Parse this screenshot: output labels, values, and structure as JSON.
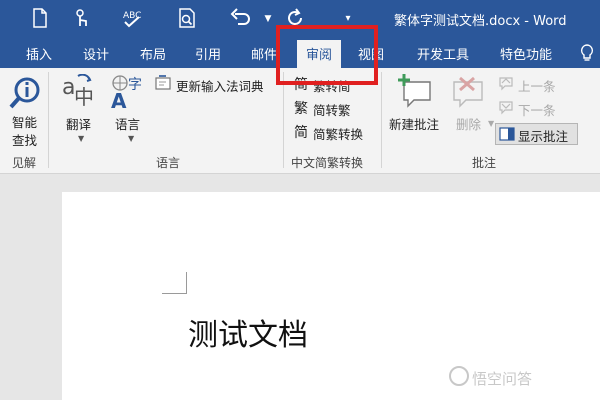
{
  "window": {
    "title": "繁体字测试文档.docx - Word"
  },
  "quick_access": {
    "new_icon": "new-document-icon",
    "touch_icon": "touch-mode-icon",
    "spelling_icon": "spelling-grammar-icon",
    "preview_icon": "print-preview-icon",
    "undo_icon": "undo-icon",
    "redo_icon": "redo-icon",
    "customize_icon": "customize-qat-icon"
  },
  "tabs": [
    {
      "label": "插入"
    },
    {
      "label": "设计"
    },
    {
      "label": "布局"
    },
    {
      "label": "引用"
    },
    {
      "label": "邮件"
    },
    {
      "label": "审阅",
      "active": true
    },
    {
      "label": "视图"
    },
    {
      "label": "开发工具"
    },
    {
      "label": "特色功能"
    }
  ],
  "ribbon": {
    "smart_lookup": {
      "line1": "智能",
      "line2": "查找"
    },
    "group_insights": "见解",
    "translate": "翻译",
    "language": "语言",
    "update_ime": "更新输入法词典",
    "group_language": "语言",
    "trad_to_simp": "繁转简",
    "simp_to_trad": "简转繁",
    "simp_trad_convert": "简繁转换",
    "group_chinese": "中文简繁转换",
    "new_comment": "新建批注",
    "delete": "删除",
    "prev": "上一条",
    "next": "下一条",
    "show_comments": "显示批注",
    "group_comments": "批注"
  },
  "document": {
    "text": "测试文档"
  },
  "watermark": "悟空问答",
  "colors": {
    "accent": "#2b579a",
    "highlight": "#e02020"
  }
}
